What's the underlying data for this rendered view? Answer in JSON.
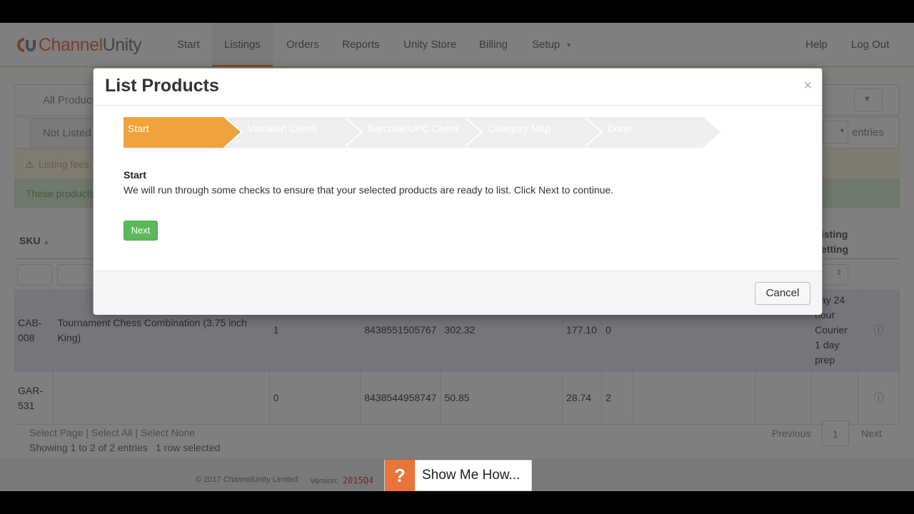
{
  "app": {
    "logo_word_a": "Channel",
    "logo_word_b": "Unity"
  },
  "nav": {
    "items": [
      {
        "label": "Start"
      },
      {
        "label": "Listings"
      },
      {
        "label": "Orders"
      },
      {
        "label": "Reports"
      },
      {
        "label": "Unity Store"
      },
      {
        "label": "Billing"
      },
      {
        "label": "Setup"
      }
    ],
    "active": "Listings",
    "right": [
      {
        "label": "Help"
      },
      {
        "label": "Log Out"
      }
    ]
  },
  "background": {
    "filter_select": "All Product",
    "status_tab": "Not Listed",
    "entries_label": "entries",
    "warning_text": "Listing fees",
    "success_text": "These products",
    "table": {
      "sku_header": "SKU",
      "listing_header_1": "isting",
      "listing_header_2": "etting",
      "rows": [
        {
          "sku": "CAB-008",
          "name": "Tournament Chess Combination (3.75 inch King)",
          "qty": "1",
          "barcode": "8438551505767",
          "price": "302.32",
          "cost": "177.10",
          "n": "0",
          "ship": "pay 24 hour Courier 1 day prep",
          "selected": true
        },
        {
          "sku": "GAR-531",
          "name": "",
          "qty": "0",
          "barcode": "8438544958747",
          "price": "50.85",
          "cost": "28.74",
          "n": "2",
          "ship": "",
          "selected": false
        }
      ]
    },
    "select_links": "Select Page | Select All | Select None",
    "showing": "Showing 1 to 2 of 2 entries",
    "selected_count": "1 row selected",
    "pager": {
      "previous": "Previous",
      "page": "1",
      "next": "Next"
    }
  },
  "modal": {
    "title": "List Products",
    "close": "×",
    "steps": [
      {
        "label": "Start",
        "active": true
      },
      {
        "label": "Variation Check",
        "active": false
      },
      {
        "label": "Barcode/UPC Check",
        "active": false
      },
      {
        "label": "Category Map",
        "active": false
      },
      {
        "label": "Done",
        "active": false
      }
    ],
    "content_title": "Start",
    "content_text": "We will run through some checks to ensure that your selected products are ready to list. Click Next to continue.",
    "next_label": "Next",
    "cancel_label": "Cancel"
  },
  "footer": {
    "copyright": "© 2017 ChannelUnity Limited",
    "version_label": "Version:",
    "version_value": "2015Q4"
  },
  "help_widget": {
    "icon": "?",
    "label": "Show Me How..."
  },
  "colors": {
    "accent_orange": "#f0a23c",
    "brand_orange": "#e9825a",
    "next_green": "#5cb85c"
  }
}
